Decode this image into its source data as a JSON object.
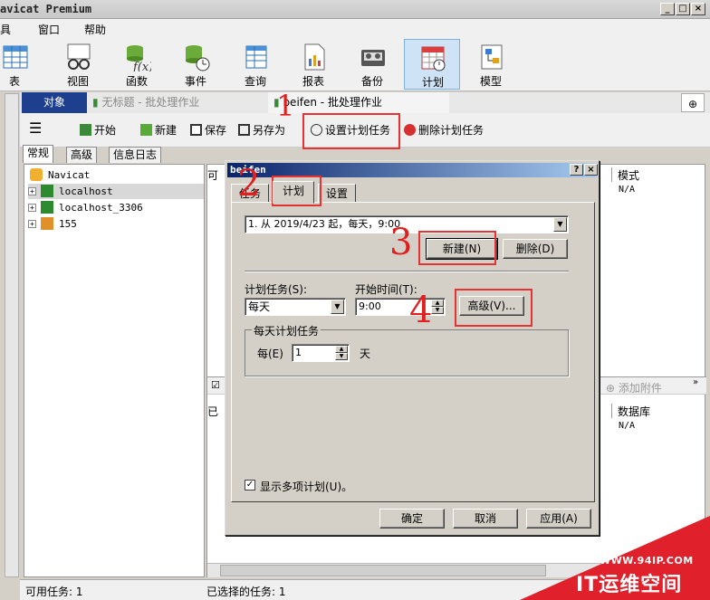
{
  "app": {
    "title": "avicat Premium"
  },
  "menu": [
    "具",
    "窗口",
    "帮助"
  ],
  "toolbar": {
    "items": [
      {
        "label": "表"
      },
      {
        "label": "视图"
      },
      {
        "label": "函数"
      },
      {
        "label": "事件"
      },
      {
        "label": "查询"
      },
      {
        "label": "报表"
      },
      {
        "label": "备份"
      },
      {
        "label": "计划"
      },
      {
        "label": "模型"
      }
    ]
  },
  "doctabs": {
    "objects": "对象",
    "untitled": "无标题 - 批处理作业",
    "beifen": "beifen - 批处理作业"
  },
  "subtoolbar": {
    "start": "开始",
    "new": "新建",
    "save": "保存",
    "saveas": "另存为",
    "set_schedule": "设置计划任务",
    "delete_schedule": "删除计划任务"
  },
  "sidetabs": [
    "常规",
    "高级",
    "信息日志"
  ],
  "tree": [
    "Navicat",
    "localhost",
    "localhost_3306",
    "155"
  ],
  "rightpane": {
    "col_mode": "模式",
    "na1": "N/A",
    "col_db": "数据库",
    "na2": "N/A",
    "add_attachment": "添加附件",
    "avail_prefix": "可",
    "selected_prefix": "已"
  },
  "status": {
    "available": "可用任务: 1",
    "selected": "已选择的任务: 1"
  },
  "dialog": {
    "title": "beifen",
    "tabs": [
      "任务",
      "计划",
      "设置"
    ],
    "schedule_value": "1. 从 2019/4/23 起，每天，9:00",
    "new_btn": "新建(N)",
    "delete_btn": "删除(D)",
    "schedule_task_label": "计划任务(S):",
    "schedule_task_value": "每天",
    "start_time_label": "开始时间(T):",
    "start_time_value": "9:00",
    "advanced_btn": "高级(V)...",
    "group_title": "每天计划任务",
    "every_label": "每(E)",
    "every_value": "1",
    "day_unit": "天",
    "show_multiple": "显示多项计划(U)。",
    "ok": "确定",
    "cancel": "取消",
    "apply": "应用(A)"
  },
  "annotations": [
    "1",
    "2",
    "3",
    "4"
  ],
  "watermark": {
    "url": "WWW.94IP.COM",
    "text": "IT运维空间"
  }
}
